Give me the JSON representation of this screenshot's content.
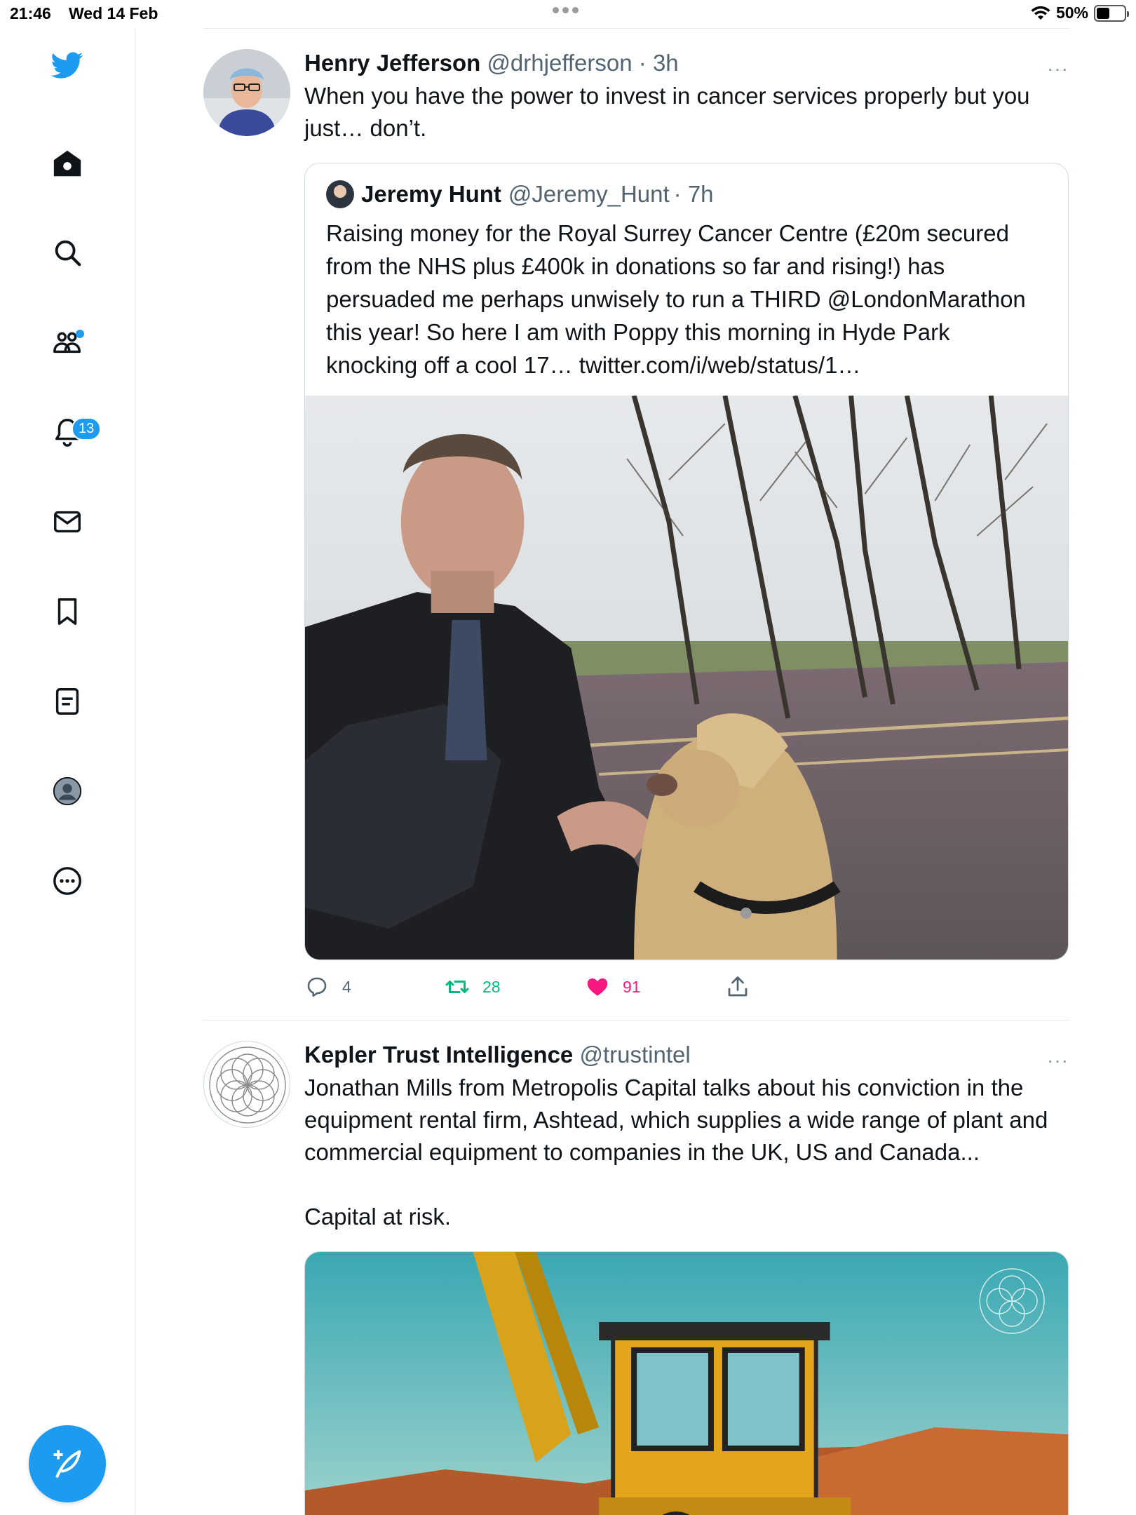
{
  "status_bar": {
    "time": "21:46",
    "date": "Wed 14 Feb",
    "battery": "50%"
  },
  "sidebar": {
    "items": [
      {
        "name": "twitter-logo",
        "icon": "bird-icon"
      },
      {
        "name": "home",
        "icon": "home-icon"
      },
      {
        "name": "explore",
        "icon": "search-icon"
      },
      {
        "name": "communities",
        "icon": "communities-icon"
      },
      {
        "name": "notifications",
        "icon": "bell-icon"
      },
      {
        "name": "messages",
        "icon": "mail-icon"
      },
      {
        "name": "bookmarks",
        "icon": "bookmark-icon"
      },
      {
        "name": "lists",
        "icon": "list-icon"
      },
      {
        "name": "profile",
        "icon": "avatar-icon"
      },
      {
        "name": "more",
        "icon": "more-circle-icon"
      }
    ],
    "notifications_badge": "13",
    "compose_icon": "compose-feather-icon"
  },
  "colors": {
    "accent": "#1d9bf0",
    "retweet": "#00ba7c",
    "like": "#f91880",
    "muted": "#536471"
  },
  "tweets": [
    {
      "name": "Henry Jefferson",
      "handle": "@drhjefferson",
      "time": "· 3h",
      "text": "When you have the power to invest in cancer services properly but you just… don’t.",
      "quote": {
        "name": "Jeremy Hunt",
        "handle": "@Jeremy_Hunt",
        "time": "· 7h",
        "text": "Raising money for the Royal Surrey Cancer Centre (£20m secured from the NHS plus £400k in donations so far and rising!) has persuaded me perhaps unwisely to run a THIRD @LondonMarathon this year! So here I am with Poppy this morning in Hyde Park knocking off a cool 17… twitter.com/i/web/status/1…"
      },
      "actions": {
        "replies": "4",
        "retweets": "28",
        "likes": "91"
      }
    },
    {
      "name": "Kepler Trust Intelligence",
      "handle": "@trustintel",
      "text": "Jonathan Mills from Metropolis Capital talks about his conviction in the equipment rental firm, Ashtead, which supplies a wide range of plant and commercial equipment to companies in the UK, US and Canada...",
      "text2": "Capital at risk."
    }
  ],
  "more_label": "···"
}
